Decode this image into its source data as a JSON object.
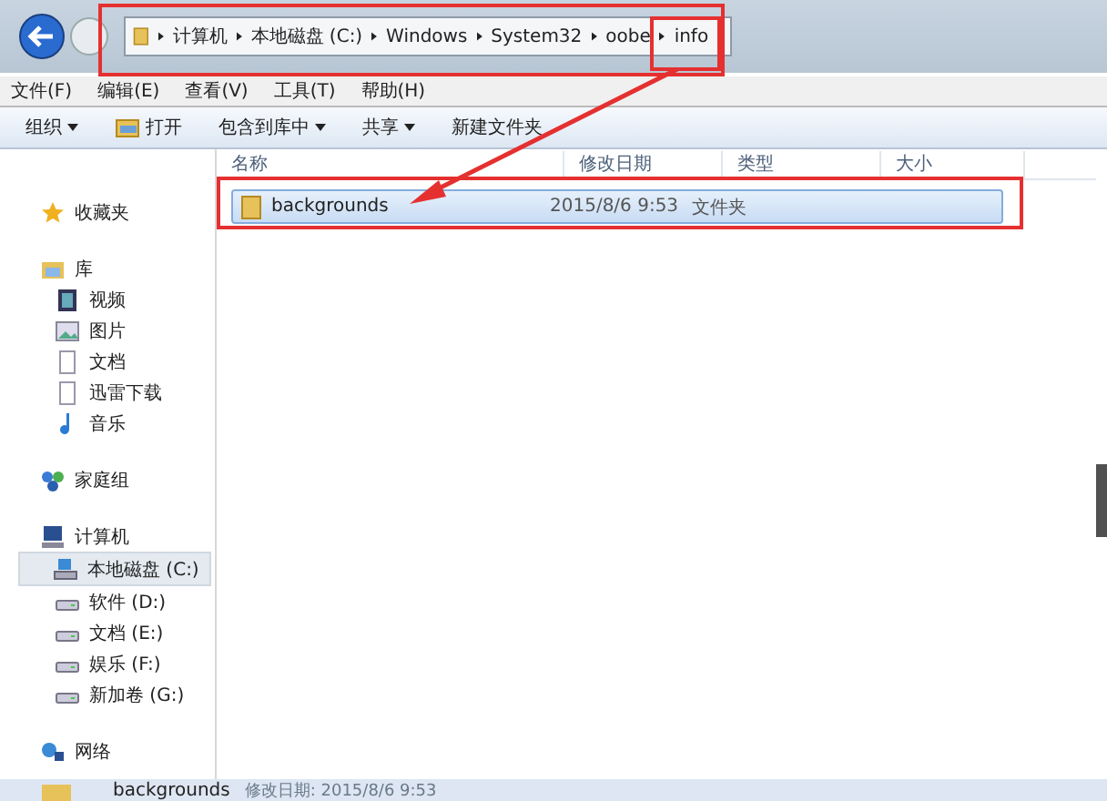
{
  "address": {
    "segments": [
      "计算机",
      "本地磁盘 (C:)",
      "Windows",
      "System32",
      "oobe",
      "info"
    ]
  },
  "menu": [
    "文件(F)",
    "编辑(E)",
    "查看(V)",
    "工具(T)",
    "帮助(H)"
  ],
  "toolbar": [
    {
      "label": "组织",
      "kind": "menu"
    },
    {
      "label": "打开",
      "kind": "icon"
    },
    {
      "label": "包含到库中",
      "kind": "menu"
    },
    {
      "label": "共享",
      "kind": "menu"
    },
    {
      "label": "新建文件夹",
      "kind": "plain"
    }
  ],
  "sidebar": [
    {
      "label": "收藏夹",
      "kind": "star",
      "selected": false
    },
    {
      "label": "库",
      "kind": "library",
      "selected": false,
      "children": [
        {
          "label": "视频",
          "kind": "video",
          "selected": false
        },
        {
          "label": "图片",
          "kind": "picture",
          "selected": false
        },
        {
          "label": "文档",
          "kind": "document",
          "selected": false
        },
        {
          "label": "迅雷下载",
          "kind": "document",
          "selected": false
        },
        {
          "label": "音乐",
          "kind": "music",
          "selected": false
        }
      ]
    },
    {
      "label": "家庭组",
      "kind": "homegroup",
      "selected": false
    },
    {
      "label": "计算机",
      "kind": "computer",
      "selected": false,
      "children": [
        {
          "label": "本地磁盘 (C:)",
          "kind": "system-drive",
          "selected": true
        },
        {
          "label": "软件 (D:)",
          "kind": "drive",
          "selected": false
        },
        {
          "label": "文档 (E:)",
          "kind": "drive",
          "selected": false
        },
        {
          "label": "娱乐 (F:)",
          "kind": "drive",
          "selected": false
        },
        {
          "label": "新加卷 (G:)",
          "kind": "drive",
          "selected": false
        }
      ]
    },
    {
      "label": "网络",
      "kind": "network",
      "selected": false
    }
  ],
  "table": {
    "columns": [
      "名称",
      "修改日期",
      "类型",
      "大小"
    ],
    "rows": [
      {
        "name": "backgrounds",
        "date": "2015/8/6 9:53",
        "type": "文件夹",
        "selected": true
      }
    ]
  },
  "status_bar": {
    "name": "backgrounds",
    "detail": "修改日期: 2015/8/6 9:53"
  }
}
